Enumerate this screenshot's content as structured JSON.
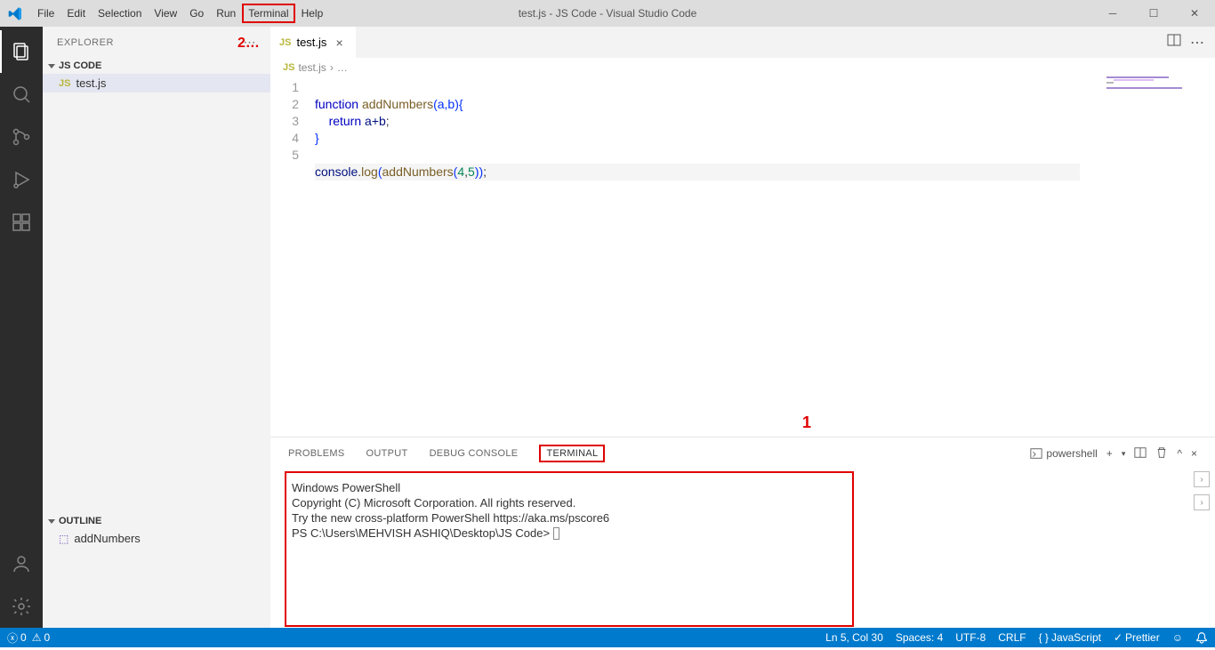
{
  "menu": {
    "file": "File",
    "edit": "Edit",
    "selection": "Selection",
    "view": "View",
    "go": "Go",
    "run": "Run",
    "terminal": "Terminal",
    "help": "Help"
  },
  "title": "test.js - JS Code - Visual Studio Code",
  "annotations": {
    "one": "1",
    "two": "2…"
  },
  "sidebar": {
    "explorer": "EXPLORER",
    "root": "JS CODE",
    "file": "test.js",
    "outline_label": "OUTLINE",
    "outline_item": "addNumbers"
  },
  "tab": {
    "name": "test.js"
  },
  "breadcrumb": {
    "file": "test.js",
    "sep": "›",
    "rest": "…"
  },
  "code": {
    "gutter": [
      "1",
      "2",
      "3",
      "4",
      "5"
    ],
    "l1": {
      "kw1": "function",
      "fn": "addNumbers",
      "args": "(a,b)",
      "brace": "{"
    },
    "l2": {
      "kw": "return",
      "expr": "a+b",
      "semi": ";"
    },
    "l3": "}",
    "l5": {
      "obj": "console",
      "dot": ".",
      "method": "log",
      "open": "(",
      "fn": "addNumbers",
      "open2": "(",
      "a": "4",
      "comma": ",",
      "b": "5",
      "close2": ")",
      "close": ")",
      "semi": ";"
    }
  },
  "panel": {
    "problems": "PROBLEMS",
    "output": "OUTPUT",
    "debug": "DEBUG CONSOLE",
    "terminal": "TERMINAL",
    "shell": "powershell"
  },
  "terminal": {
    "l1": "Windows PowerShell",
    "l2": "Copyright (C) Microsoft Corporation. All rights reserved.",
    "l3": "",
    "l4": "Try the new cross-platform PowerShell https://aka.ms/pscore6",
    "l5": "",
    "prompt": "PS C:\\Users\\MEHVISH ASHIQ\\Desktop\\JS Code> "
  },
  "status": {
    "errors": "0",
    "warnings": "0",
    "ln": "Ln 5, Col 30",
    "spaces": "Spaces: 4",
    "enc": "UTF-8",
    "eol": "CRLF",
    "lang": "JavaScript",
    "prettier": "Prettier"
  }
}
